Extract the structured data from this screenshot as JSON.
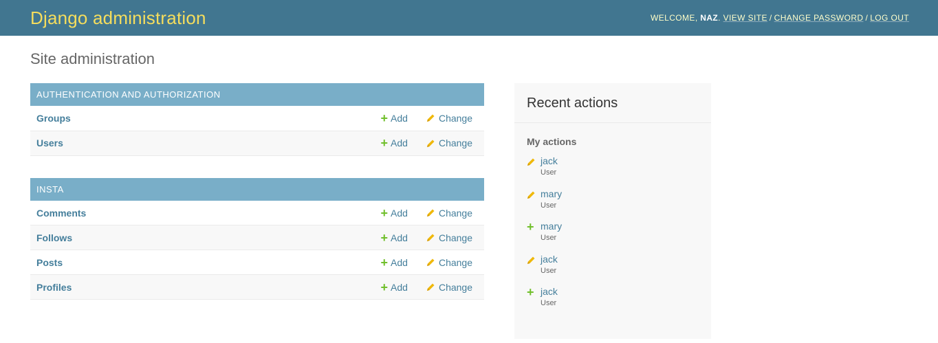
{
  "header": {
    "branding": "Django administration",
    "welcome": "Welcome,",
    "username": "naz",
    "links": [
      "View site",
      "Change password",
      "Log out"
    ]
  },
  "page_title": "Site administration",
  "modules": [
    {
      "caption": "Authentication and Authorization",
      "rows": [
        {
          "name": "Groups",
          "add": "Add",
          "change": "Change"
        },
        {
          "name": "Users",
          "add": "Add",
          "change": "Change"
        }
      ]
    },
    {
      "caption": "Insta",
      "rows": [
        {
          "name": "Comments",
          "add": "Add",
          "change": "Change"
        },
        {
          "name": "Follows",
          "add": "Add",
          "change": "Change"
        },
        {
          "name": "Posts",
          "add": "Add",
          "change": "Change"
        },
        {
          "name": "Profiles",
          "add": "Add",
          "change": "Change"
        }
      ]
    }
  ],
  "recent": {
    "title": "Recent actions",
    "subtitle": "My actions",
    "actions": [
      {
        "icon": "pencil-icon",
        "name": "jack",
        "type": "User"
      },
      {
        "icon": "pencil-icon",
        "name": "mary",
        "type": "User"
      },
      {
        "icon": "plus-icon",
        "name": "mary",
        "type": "User"
      },
      {
        "icon": "pencil-icon",
        "name": "jack",
        "type": "User"
      },
      {
        "icon": "plus-icon",
        "name": "jack",
        "type": "User"
      }
    ]
  },
  "colors": {
    "header_bg": "#417690",
    "branding": "#f5dd5d",
    "caption_bg": "#79aec8",
    "link": "#447e9b",
    "add_green": "#70bf2b",
    "change_yellow": "#efb80b"
  }
}
